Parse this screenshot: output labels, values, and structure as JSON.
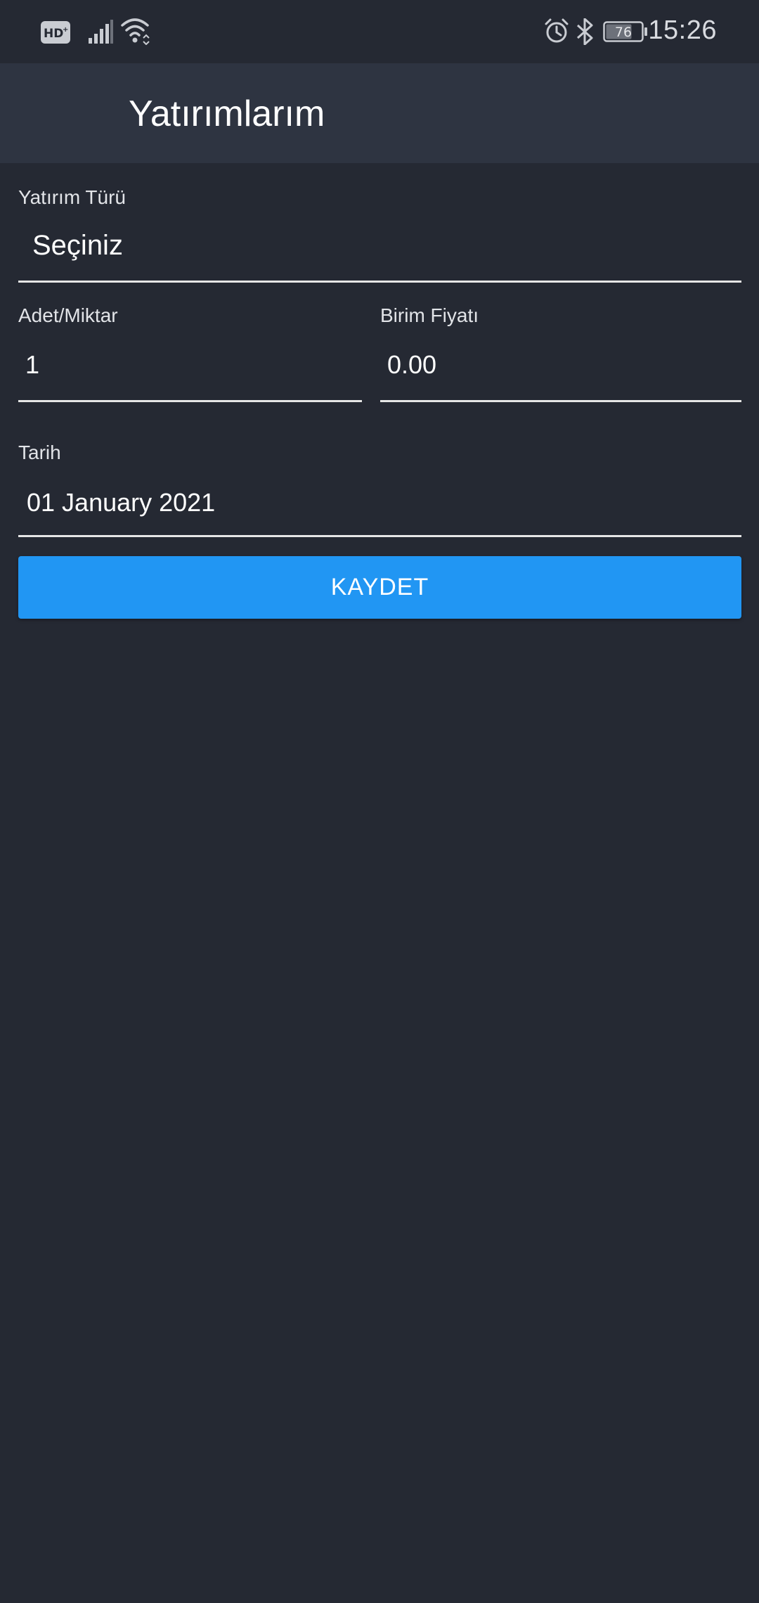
{
  "status_bar": {
    "time": "15:26",
    "battery_level": "76",
    "left_icons": [
      "hd-plus-icon",
      "signal-icon",
      "wifi-icon"
    ],
    "right_icons": [
      "alarm-icon",
      "bluetooth-icon",
      "battery-icon"
    ]
  },
  "app_bar": {
    "title": "Yatırımlarım"
  },
  "form": {
    "investment_type": {
      "label": "Yatırım Türü",
      "value": "Seçiniz"
    },
    "quantity": {
      "label": "Adet/Miktar",
      "value": "1"
    },
    "unit_price": {
      "label": "Birim Fiyatı",
      "value": "0.00"
    },
    "date": {
      "label": "Tarih",
      "value": "01 January 2021"
    },
    "save_label": "KAYDET"
  },
  "colors": {
    "background": "#252933",
    "app_bar": "#2e3441",
    "accent": "#2196f3",
    "text": "#ffffff"
  }
}
